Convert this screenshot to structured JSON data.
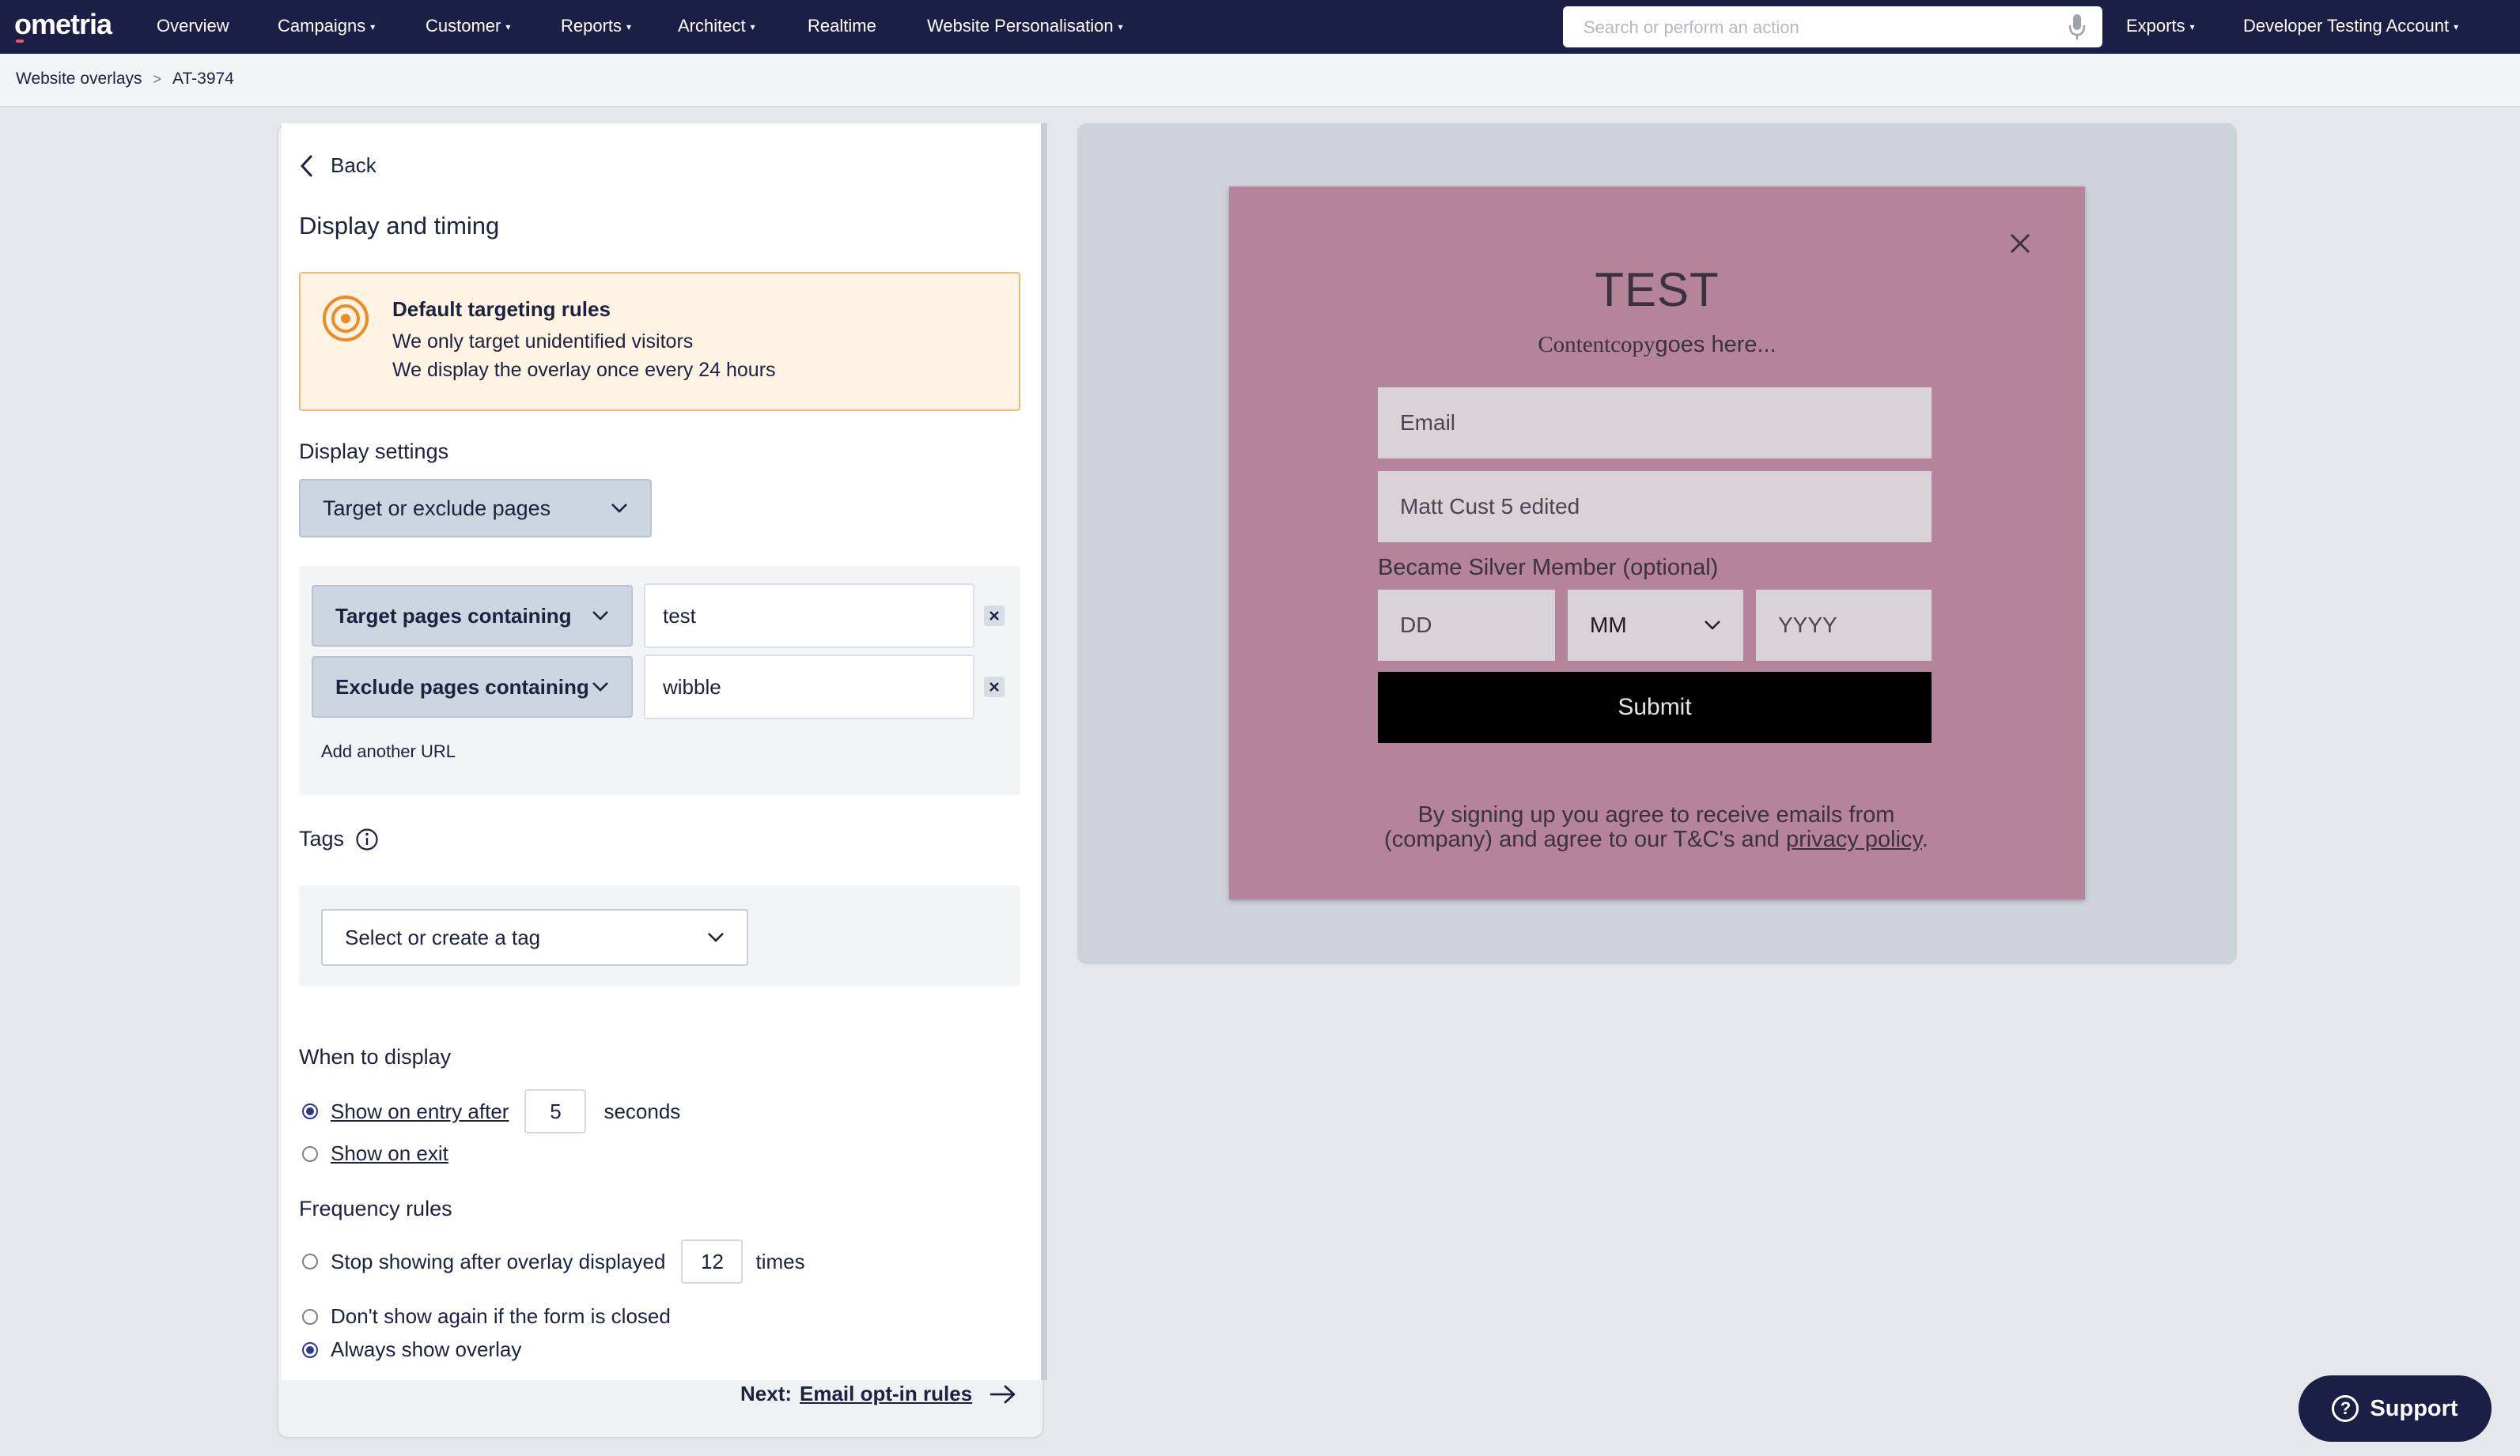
{
  "topbar": {
    "logo": "ometria",
    "nav": [
      {
        "label": "Overview",
        "caret": false
      },
      {
        "label": "Campaigns",
        "caret": true
      },
      {
        "label": "Customer",
        "caret": true
      },
      {
        "label": "Reports",
        "caret": true
      },
      {
        "label": "Architect",
        "caret": true
      },
      {
        "label": "Realtime",
        "caret": false
      },
      {
        "label": "Website Personalisation",
        "caret": true
      }
    ],
    "search_placeholder": "Search or perform an action",
    "exports_label": "Exports",
    "account_label": "Developer Testing Account"
  },
  "breadcrumb": {
    "root": "Website overlays",
    "separator": ">",
    "current": "AT-3974"
  },
  "panel": {
    "back_label": "Back",
    "heading": "Display and timing",
    "targeting": {
      "title": "Default targeting rules",
      "line1": "We only target unidentified visitors",
      "line2": "We display the overlay once every 24 hours"
    },
    "display_settings_label": "Display settings",
    "display_settings_value": "Target or exclude pages",
    "url_rules": [
      {
        "mode": "Target pages containing",
        "value": "test"
      },
      {
        "mode": "Exclude pages containing",
        "value": "wibble"
      }
    ],
    "add_url_label": "Add another URL",
    "tags_label": "Tags",
    "tag_placeholder": "Select or create a tag",
    "when_label": "When to display",
    "entry_option": "Show on entry after",
    "entry_seconds": "5",
    "seconds_label": "seconds",
    "exit_option": "Show on exit",
    "frequency_label": "Frequency rules",
    "freq_stop": "Stop showing after overlay displayed",
    "freq_times_value": "12",
    "times_label": "times",
    "freq_closed": "Don't show again if the form is closed",
    "freq_always": "Always show overlay",
    "selected_when": "entry",
    "selected_frequency": "always",
    "next_prefix": "Next:",
    "next_link": "Email opt-in rules"
  },
  "preview": {
    "title": "TEST",
    "copy_serif": "Contentcopy",
    "copy_rest": "goes here...",
    "email_placeholder": "Email",
    "name_value": "Matt Cust 5 edited",
    "date_label": "Became Silver Member (optional)",
    "dd_placeholder": "DD",
    "mm_value": "MM",
    "yyyy_placeholder": "YYYY",
    "submit_label": "Submit",
    "terms_text": "By signing up you agree to receive emails from (company) and agree to our T&C's and ",
    "terms_link": "privacy policy",
    "terms_end": "."
  },
  "support_label": "Support",
  "colors": {
    "nav_bg": "#1c1f45",
    "overlay_bg": "#c98ea6",
    "accent_orange": "#f08a24",
    "radio_on": "#2d3a8c"
  }
}
